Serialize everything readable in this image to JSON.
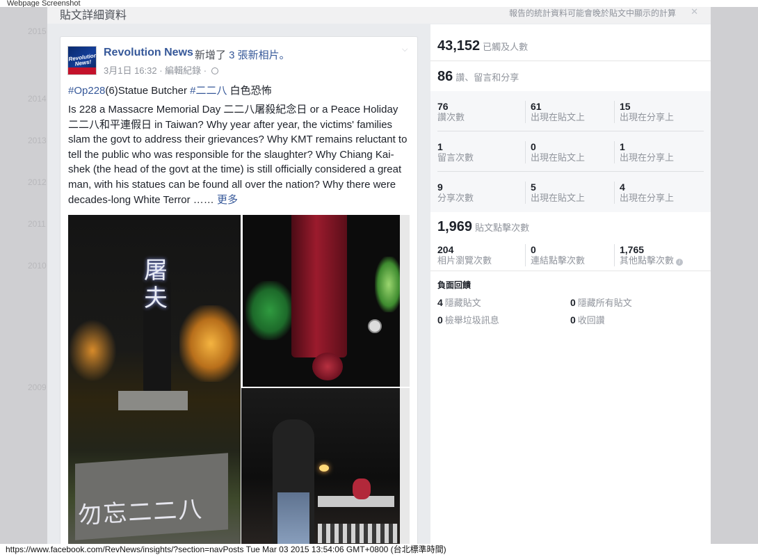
{
  "screenshot_label": "Webpage Screenshot",
  "dialog": {
    "title": "貼文詳細資料",
    "note": "報告的統計資料可能會晚於貼文中顯示的計算",
    "close_glyph": "✕"
  },
  "backdrop_years": [
    "2015",
    "2014",
    "2013",
    "2012",
    "2011",
    "2010",
    "2009"
  ],
  "post": {
    "page_name": "Revolution News",
    "action_prefix": "新增了 ",
    "action_count": "3",
    "action_suffix": " 張新相片。",
    "date": "3月1日 16:32",
    "meta_sep": " · ",
    "edit_history": "編輯紀錄",
    "hashtag1": "#Op228",
    "hashtag_mid": "(6)Statue Butcher ",
    "hashtag2": "#二二八",
    "hashtag_tail": " 白色恐怖",
    "body": "Is 228 a Massacre Memorial Day 二二八屠殺紀念日 or a Peace Holiday 二二八和平連假日 in Taiwan? Why year after year, the victims' families slam the govt to address their grievances? Why KMT remains reluctant to tell the public who was responsible for the slaughter? Why Chiang Kai-shek (the head of the govt at the time) is still officially considered a great man, with his statues can be found all over the nation? Why there were decades-long White Terror …… ",
    "see_more": "更多",
    "avatar_text": "Revolution News!",
    "photo1_graffiti_top": "屠夫",
    "photo1_graffiti_bottom": "勿忘二二八"
  },
  "stats": {
    "reach_value": "43,152",
    "reach_label": "已觸及人數",
    "engagement_value": "86",
    "engagement_label": "讚、留言和分享",
    "grid": [
      [
        {
          "num": "76",
          "label": "讚次數"
        },
        {
          "num": "61",
          "label": "出現在貼文上"
        },
        {
          "num": "15",
          "label": "出現在分享上"
        }
      ],
      [
        {
          "num": "1",
          "label": "留言次數"
        },
        {
          "num": "0",
          "label": "出現在貼文上"
        },
        {
          "num": "1",
          "label": "出現在分享上"
        }
      ],
      [
        {
          "num": "9",
          "label": "分享次數"
        },
        {
          "num": "5",
          "label": "出現在貼文上"
        },
        {
          "num": "4",
          "label": "出現在分享上"
        }
      ]
    ],
    "clicks_value": "1,969",
    "clicks_label": "貼文點擊次數",
    "clicks": [
      {
        "num": "204",
        "label": "相片瀏覽次數"
      },
      {
        "num": "0",
        "label": "連結點擊次數"
      },
      {
        "num": "1,765",
        "label": "其他點擊次數"
      }
    ],
    "negative_title": "負面回饋",
    "negative": [
      {
        "num": "4",
        "label": "隱藏貼文"
      },
      {
        "num": "0",
        "label": "隱藏所有貼文"
      },
      {
        "num": "0",
        "label": "檢舉垃圾訊息"
      },
      {
        "num": "0",
        "label": "收回讚"
      }
    ]
  },
  "statusbar": "https://www.facebook.com/RevNews/insights/?section=navPosts Tue Mar 03 2015 13:54:06 GMT+0800 (台北標準時間)"
}
